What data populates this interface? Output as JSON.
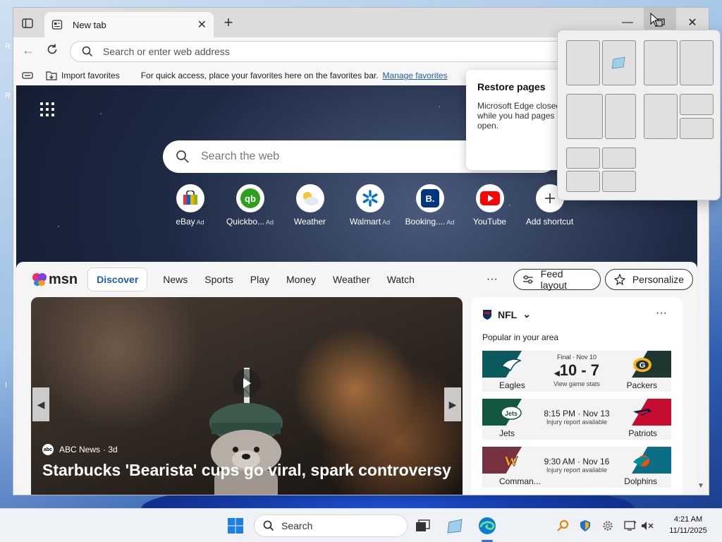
{
  "desktop": {
    "edge_letters": [
      "R",
      "R",
      "I"
    ]
  },
  "browser": {
    "tab": {
      "title": "New tab"
    },
    "address": {
      "placeholder": "Search or enter web address"
    },
    "favorites_bar": {
      "import_label": "Import favorites",
      "hint": "For quick access, place your favorites here on the favorites bar.",
      "manage_label": "Manage favorites"
    }
  },
  "ntp": {
    "search_placeholder": "Search the web",
    "shortcuts": [
      {
        "label": "eBay",
        "ad": "Ad",
        "icon": "ebay-icon"
      },
      {
        "label": "Quickbo...",
        "ad": "Ad",
        "icon": "quickbooks-icon"
      },
      {
        "label": "Weather",
        "ad": "",
        "icon": "weather-icon"
      },
      {
        "label": "Walmart",
        "ad": "Ad",
        "icon": "walmart-icon"
      },
      {
        "label": "Booking....",
        "ad": "Ad",
        "icon": "booking-icon"
      },
      {
        "label": "YouTube",
        "ad": "",
        "icon": "youtube-icon"
      },
      {
        "label": "Add shortcut",
        "ad": "",
        "icon": "plus-icon"
      }
    ]
  },
  "feed": {
    "logo": "msn",
    "tabs": [
      "Discover",
      "News",
      "Sports",
      "Play",
      "Money",
      "Weather",
      "Watch"
    ],
    "more": "···",
    "feed_layout_label": "Feed layout",
    "personalize_label": "Personalize",
    "hero": {
      "source": "ABC News",
      "source_logo": "abc",
      "age": "· 3d",
      "title": "Starbucks 'Bearista' cups go viral, spark controversy"
    },
    "nfl": {
      "league": "NFL",
      "subtitle": "Popular in your area",
      "more": "···",
      "games": [
        {
          "home": "Eagles",
          "away": "Packers",
          "status": "Final · Nov 10",
          "score": "10 - 7",
          "note": "View game stats",
          "home_color": "#0a5a5e",
          "away_color": "#203731"
        },
        {
          "home": "Jets",
          "away": "Patriots",
          "status": "",
          "time": "8:15 PM · Nov 13",
          "note": "Injury report available",
          "home_color": "#125740",
          "away_color": "#c60c30"
        },
        {
          "home": "Comman...",
          "away": "Dolphins",
          "status": "",
          "time": "9:30 AM · Nov 16",
          "note": "Injury report available",
          "home_color": "#773141",
          "away_color": "#0b6e85"
        }
      ]
    }
  },
  "restore": {
    "title": "Restore pages",
    "message": "Microsoft Edge closed while you had pages open."
  },
  "taskbar": {
    "search_label": "Search",
    "time": "4:21 AM",
    "date": "11/11/2025"
  },
  "colors": {
    "accent": "#1a5fb4",
    "edge_blue": "#0c7bd8"
  }
}
